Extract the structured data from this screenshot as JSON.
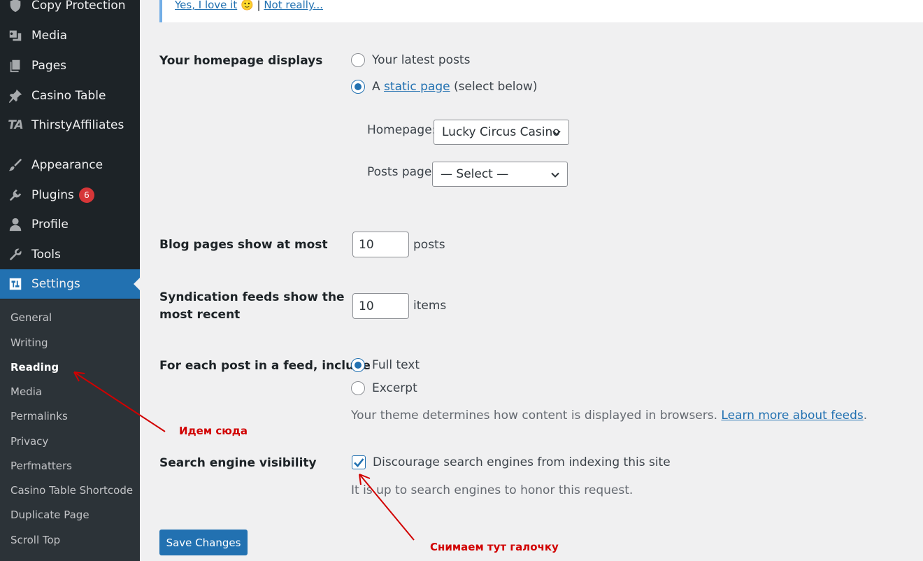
{
  "sidebar": {
    "items": [
      {
        "label": "Copy Protection",
        "icon": "shield-icon"
      },
      {
        "label": "Media",
        "icon": "media-icon"
      },
      {
        "label": "Pages",
        "icon": "pages-icon"
      },
      {
        "label": "Casino Table",
        "icon": "pin-icon"
      },
      {
        "label": "ThirstyAffiliates",
        "icon": "ta-logo-icon",
        "icon_text": "TA"
      },
      {
        "label": "Appearance",
        "icon": "paintbrush-icon"
      },
      {
        "label": "Plugins",
        "icon": "plug-icon",
        "badge": "6"
      },
      {
        "label": "Profile",
        "icon": "user-icon"
      },
      {
        "label": "Tools",
        "icon": "wrench-icon"
      },
      {
        "label": "Settings",
        "icon": "settings-icon",
        "active": true
      }
    ],
    "submenu": [
      "General",
      "Writing",
      "Reading",
      "Media",
      "Permalinks",
      "Privacy",
      "Perfmatters",
      "Casino Table Shortcode",
      "Duplicate Page",
      "Scroll Top"
    ],
    "current_submenu": "Reading"
  },
  "notice": {
    "yes_link": "Yes, I love it",
    "emoji": "🙂",
    "separator": "|",
    "no_link": "Not really..."
  },
  "form": {
    "homepage_displays": {
      "label": "Your homepage displays",
      "option_latest": "Your latest posts",
      "option_static_prefix": "A",
      "option_static_link": "static page",
      "option_static_suffix": "(select below)",
      "selected": "static"
    },
    "homepage_select": {
      "label": "Homepage:",
      "value": "Lucky Circus Casino"
    },
    "posts_page_select": {
      "label": "Posts page:",
      "value": "— Select —"
    },
    "blog_pages": {
      "label": "Blog pages show at most",
      "value": "10",
      "suffix": "posts"
    },
    "syndication": {
      "label_line1": "Syndication feeds show the",
      "label_line2": "most recent",
      "value": "10",
      "suffix": "items"
    },
    "feed_include": {
      "label": "For each post in a feed, include",
      "option_full": "Full text",
      "option_excerpt": "Excerpt",
      "selected": "full",
      "description": "Your theme determines how content is displayed in browsers.",
      "learn_more": "Learn more about feeds",
      "period": "."
    },
    "search_visibility": {
      "label": "Search engine visibility",
      "checkbox_label": "Discourage search engines from indexing this site",
      "checked": true,
      "description": "It is up to search engines to honor this request."
    },
    "save_button": "Save Changes"
  },
  "annotations": {
    "go_here": "Идем сюда",
    "uncheck_here": "Снимаем тут галочку",
    "color": "#d10000"
  },
  "colors": {
    "sidebar_bg": "#1d2327",
    "submenu_bg": "#2c3338",
    "accent": "#2271b1",
    "badge": "#d63638",
    "page_bg": "#f0f0f1"
  }
}
